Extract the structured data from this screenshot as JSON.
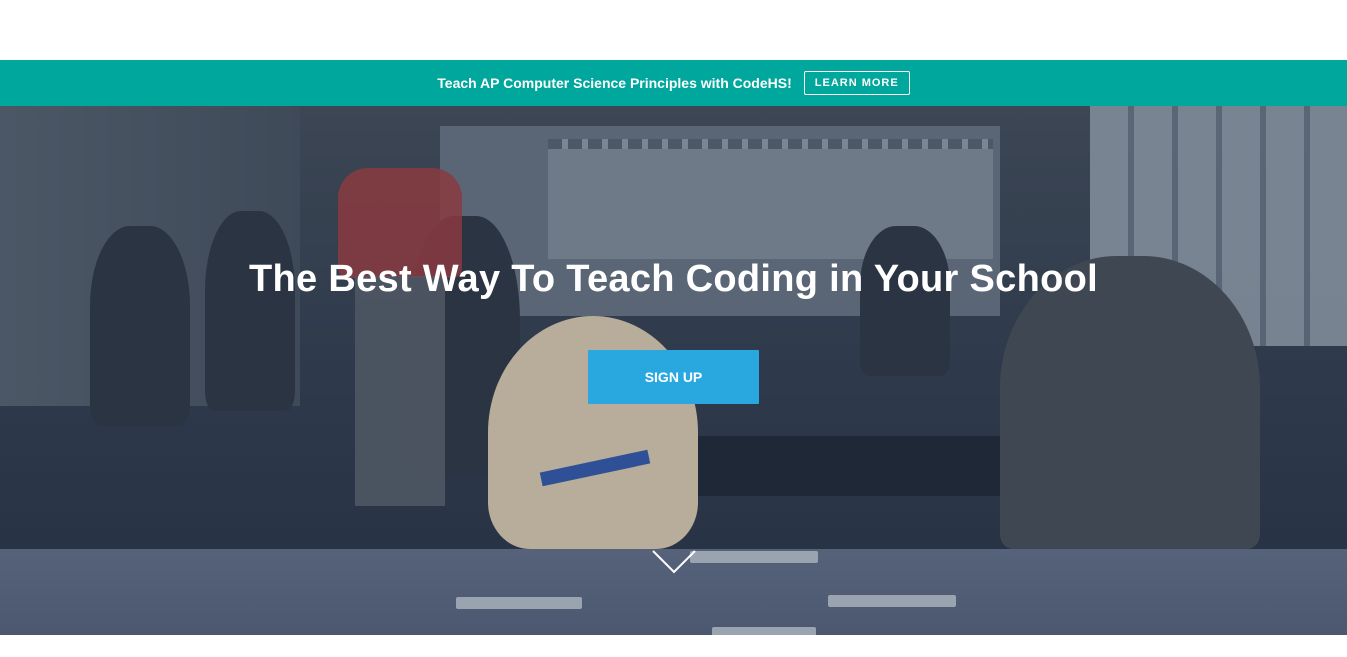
{
  "promo": {
    "text": "Teach AP Computer Science Principles with CodeHS!",
    "button_label": "LEARN MORE"
  },
  "hero": {
    "title": "The Best Way To Teach Coding in Your School",
    "signup_label": "SIGN UP"
  },
  "icons": {
    "scroll_down": "chevron-down-icon"
  },
  "colors": {
    "promo_bar": "#00a79d",
    "signup_button": "#29a8e0",
    "hero_overlay": "#2f3b4c",
    "text": "#ffffff"
  }
}
